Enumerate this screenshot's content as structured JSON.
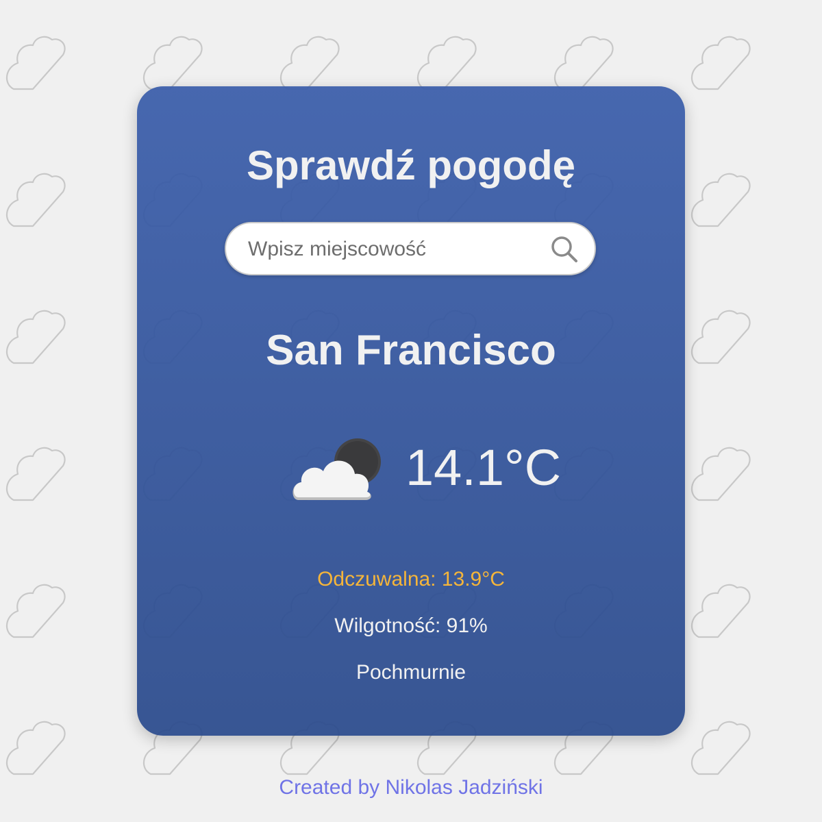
{
  "header": {
    "title": "Sprawdź pogodę"
  },
  "search": {
    "placeholder": "Wpisz miejscowość",
    "icon": "search-icon"
  },
  "weather": {
    "city": "San Francisco",
    "icon": "cloud-night-icon",
    "temperature": "14.1°C",
    "feels_like": "Odczuwalna: 13.9°C",
    "humidity": "Wilgotność: 91%",
    "description": "Pochmurnie"
  },
  "footer": {
    "credit": "Created by Nikolas Jadziński"
  },
  "colors": {
    "background": "#f0f0f0",
    "card_top": "#3a5daa",
    "card_bottom": "#2a4a8c",
    "text": "#f1f1f1",
    "feels_like": "#f5b53a",
    "footer": "#6f73e6"
  }
}
